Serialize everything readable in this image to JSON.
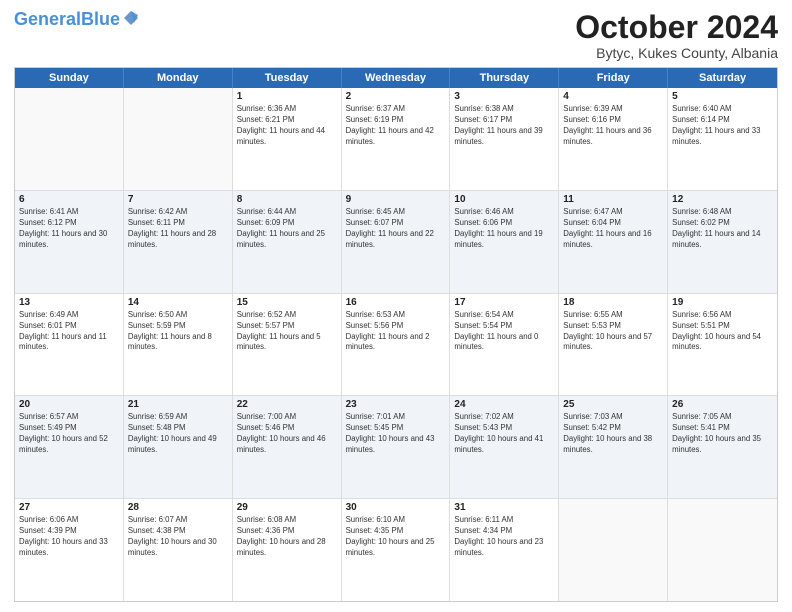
{
  "header": {
    "logo_main": "General",
    "logo_accent": "Blue",
    "month_title": "October 2024",
    "location": "Bytyc, Kukes County, Albania"
  },
  "days_of_week": [
    "Sunday",
    "Monday",
    "Tuesday",
    "Wednesday",
    "Thursday",
    "Friday",
    "Saturday"
  ],
  "weeks": [
    [
      {
        "day": "",
        "sunrise": "",
        "sunset": "",
        "daylight": "",
        "empty": true
      },
      {
        "day": "",
        "sunrise": "",
        "sunset": "",
        "daylight": "",
        "empty": true
      },
      {
        "day": "1",
        "sunrise": "Sunrise: 6:36 AM",
        "sunset": "Sunset: 6:21 PM",
        "daylight": "Daylight: 11 hours and 44 minutes."
      },
      {
        "day": "2",
        "sunrise": "Sunrise: 6:37 AM",
        "sunset": "Sunset: 6:19 PM",
        "daylight": "Daylight: 11 hours and 42 minutes."
      },
      {
        "day": "3",
        "sunrise": "Sunrise: 6:38 AM",
        "sunset": "Sunset: 6:17 PM",
        "daylight": "Daylight: 11 hours and 39 minutes."
      },
      {
        "day": "4",
        "sunrise": "Sunrise: 6:39 AM",
        "sunset": "Sunset: 6:16 PM",
        "daylight": "Daylight: 11 hours and 36 minutes."
      },
      {
        "day": "5",
        "sunrise": "Sunrise: 6:40 AM",
        "sunset": "Sunset: 6:14 PM",
        "daylight": "Daylight: 11 hours and 33 minutes."
      }
    ],
    [
      {
        "day": "6",
        "sunrise": "Sunrise: 6:41 AM",
        "sunset": "Sunset: 6:12 PM",
        "daylight": "Daylight: 11 hours and 30 minutes."
      },
      {
        "day": "7",
        "sunrise": "Sunrise: 6:42 AM",
        "sunset": "Sunset: 6:11 PM",
        "daylight": "Daylight: 11 hours and 28 minutes."
      },
      {
        "day": "8",
        "sunrise": "Sunrise: 6:44 AM",
        "sunset": "Sunset: 6:09 PM",
        "daylight": "Daylight: 11 hours and 25 minutes."
      },
      {
        "day": "9",
        "sunrise": "Sunrise: 6:45 AM",
        "sunset": "Sunset: 6:07 PM",
        "daylight": "Daylight: 11 hours and 22 minutes."
      },
      {
        "day": "10",
        "sunrise": "Sunrise: 6:46 AM",
        "sunset": "Sunset: 6:06 PM",
        "daylight": "Daylight: 11 hours and 19 minutes."
      },
      {
        "day": "11",
        "sunrise": "Sunrise: 6:47 AM",
        "sunset": "Sunset: 6:04 PM",
        "daylight": "Daylight: 11 hours and 16 minutes."
      },
      {
        "day": "12",
        "sunrise": "Sunrise: 6:48 AM",
        "sunset": "Sunset: 6:02 PM",
        "daylight": "Daylight: 11 hours and 14 minutes."
      }
    ],
    [
      {
        "day": "13",
        "sunrise": "Sunrise: 6:49 AM",
        "sunset": "Sunset: 6:01 PM",
        "daylight": "Daylight: 11 hours and 11 minutes."
      },
      {
        "day": "14",
        "sunrise": "Sunrise: 6:50 AM",
        "sunset": "Sunset: 5:59 PM",
        "daylight": "Daylight: 11 hours and 8 minutes."
      },
      {
        "day": "15",
        "sunrise": "Sunrise: 6:52 AM",
        "sunset": "Sunset: 5:57 PM",
        "daylight": "Daylight: 11 hours and 5 minutes."
      },
      {
        "day": "16",
        "sunrise": "Sunrise: 6:53 AM",
        "sunset": "Sunset: 5:56 PM",
        "daylight": "Daylight: 11 hours and 2 minutes."
      },
      {
        "day": "17",
        "sunrise": "Sunrise: 6:54 AM",
        "sunset": "Sunset: 5:54 PM",
        "daylight": "Daylight: 11 hours and 0 minutes."
      },
      {
        "day": "18",
        "sunrise": "Sunrise: 6:55 AM",
        "sunset": "Sunset: 5:53 PM",
        "daylight": "Daylight: 10 hours and 57 minutes."
      },
      {
        "day": "19",
        "sunrise": "Sunrise: 6:56 AM",
        "sunset": "Sunset: 5:51 PM",
        "daylight": "Daylight: 10 hours and 54 minutes."
      }
    ],
    [
      {
        "day": "20",
        "sunrise": "Sunrise: 6:57 AM",
        "sunset": "Sunset: 5:49 PM",
        "daylight": "Daylight: 10 hours and 52 minutes."
      },
      {
        "day": "21",
        "sunrise": "Sunrise: 6:59 AM",
        "sunset": "Sunset: 5:48 PM",
        "daylight": "Daylight: 10 hours and 49 minutes."
      },
      {
        "day": "22",
        "sunrise": "Sunrise: 7:00 AM",
        "sunset": "Sunset: 5:46 PM",
        "daylight": "Daylight: 10 hours and 46 minutes."
      },
      {
        "day": "23",
        "sunrise": "Sunrise: 7:01 AM",
        "sunset": "Sunset: 5:45 PM",
        "daylight": "Daylight: 10 hours and 43 minutes."
      },
      {
        "day": "24",
        "sunrise": "Sunrise: 7:02 AM",
        "sunset": "Sunset: 5:43 PM",
        "daylight": "Daylight: 10 hours and 41 minutes."
      },
      {
        "day": "25",
        "sunrise": "Sunrise: 7:03 AM",
        "sunset": "Sunset: 5:42 PM",
        "daylight": "Daylight: 10 hours and 38 minutes."
      },
      {
        "day": "26",
        "sunrise": "Sunrise: 7:05 AM",
        "sunset": "Sunset: 5:41 PM",
        "daylight": "Daylight: 10 hours and 35 minutes."
      }
    ],
    [
      {
        "day": "27",
        "sunrise": "Sunrise: 6:06 AM",
        "sunset": "Sunset: 4:39 PM",
        "daylight": "Daylight: 10 hours and 33 minutes."
      },
      {
        "day": "28",
        "sunrise": "Sunrise: 6:07 AM",
        "sunset": "Sunset: 4:38 PM",
        "daylight": "Daylight: 10 hours and 30 minutes."
      },
      {
        "day": "29",
        "sunrise": "Sunrise: 6:08 AM",
        "sunset": "Sunset: 4:36 PM",
        "daylight": "Daylight: 10 hours and 28 minutes."
      },
      {
        "day": "30",
        "sunrise": "Sunrise: 6:10 AM",
        "sunset": "Sunset: 4:35 PM",
        "daylight": "Daylight: 10 hours and 25 minutes."
      },
      {
        "day": "31",
        "sunrise": "Sunrise: 6:11 AM",
        "sunset": "Sunset: 4:34 PM",
        "daylight": "Daylight: 10 hours and 23 minutes."
      },
      {
        "day": "",
        "sunrise": "",
        "sunset": "",
        "daylight": "",
        "empty": true
      },
      {
        "day": "",
        "sunrise": "",
        "sunset": "",
        "daylight": "",
        "empty": true
      }
    ]
  ],
  "alt_rows": [
    1,
    3
  ]
}
